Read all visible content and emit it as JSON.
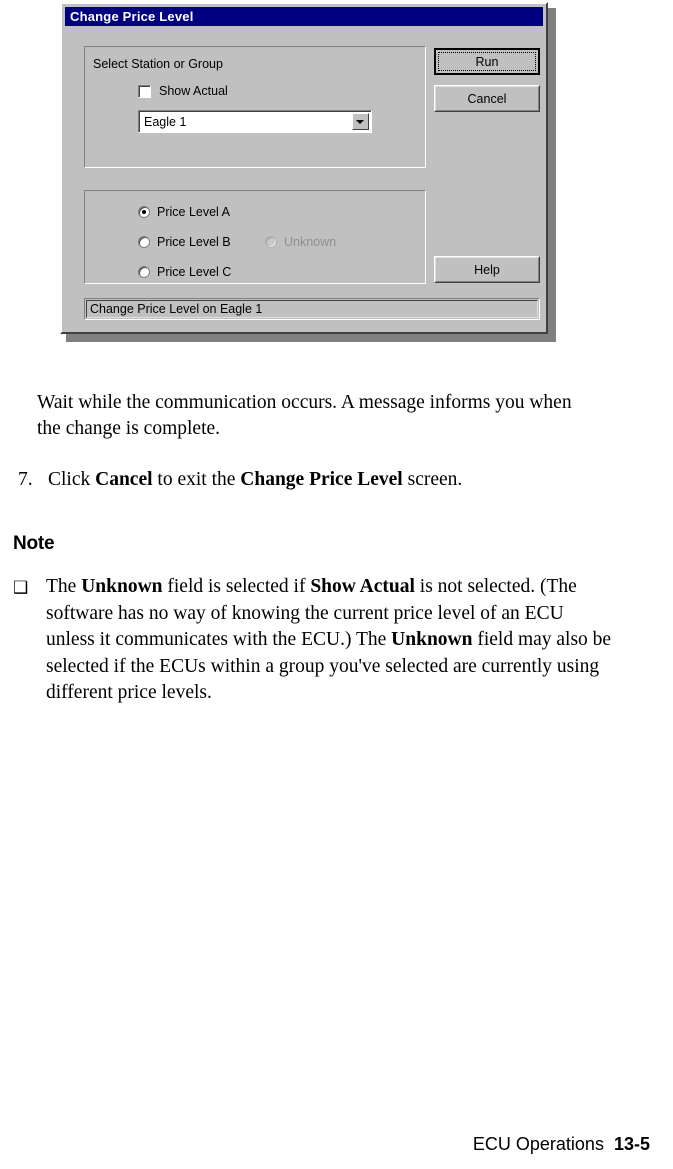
{
  "dialog": {
    "title": "Change Price Level",
    "station_group": {
      "legend": "Select Station or Group",
      "show_actual_label": "Show Actual",
      "show_actual_checked": false,
      "combo_value": "Eagle 1"
    },
    "price_levels": {
      "options": [
        {
          "label": "Price Level A",
          "selected": true,
          "disabled": false
        },
        {
          "label": "Price Level B",
          "selected": false,
          "disabled": false
        },
        {
          "label": "Price Level C",
          "selected": false,
          "disabled": false
        },
        {
          "label": "Unknown",
          "selected": false,
          "disabled": true
        }
      ]
    },
    "buttons": {
      "run": "Run",
      "cancel": "Cancel",
      "help": "Help"
    },
    "statusbar": "Change Price Level on Eagle 1",
    "colors": {
      "titlebar": "#000080",
      "face": "#c0c0c0",
      "titlebar_text": "#ffffff",
      "disabled_text": "#909090"
    }
  },
  "document": {
    "intro_paragraph": "Wait while the communication occurs. A message informs you when the change is complete.",
    "step": {
      "number": "7.",
      "text_1": "Click ",
      "bold_1": "Cancel",
      "text_2": " to exit the ",
      "bold_2": "Change Price Level",
      "text_3": " screen."
    },
    "note_heading": "Note",
    "note_bullet_glyph": "❑",
    "note": {
      "t1": "The ",
      "b1": "Unknown",
      "t2": " field is selected if ",
      "b2": "Show Actual",
      "t3": " is not selected. (The software has no way of knowing the current price level of an ECU unless it communicates with the ECU.) The ",
      "b3": "Unknown",
      "t4": " field may also be selected if the ECUs within a group you've selected are currently using different price levels."
    }
  },
  "footer": {
    "chapter": "ECU Operations",
    "page_number": "13-5"
  }
}
